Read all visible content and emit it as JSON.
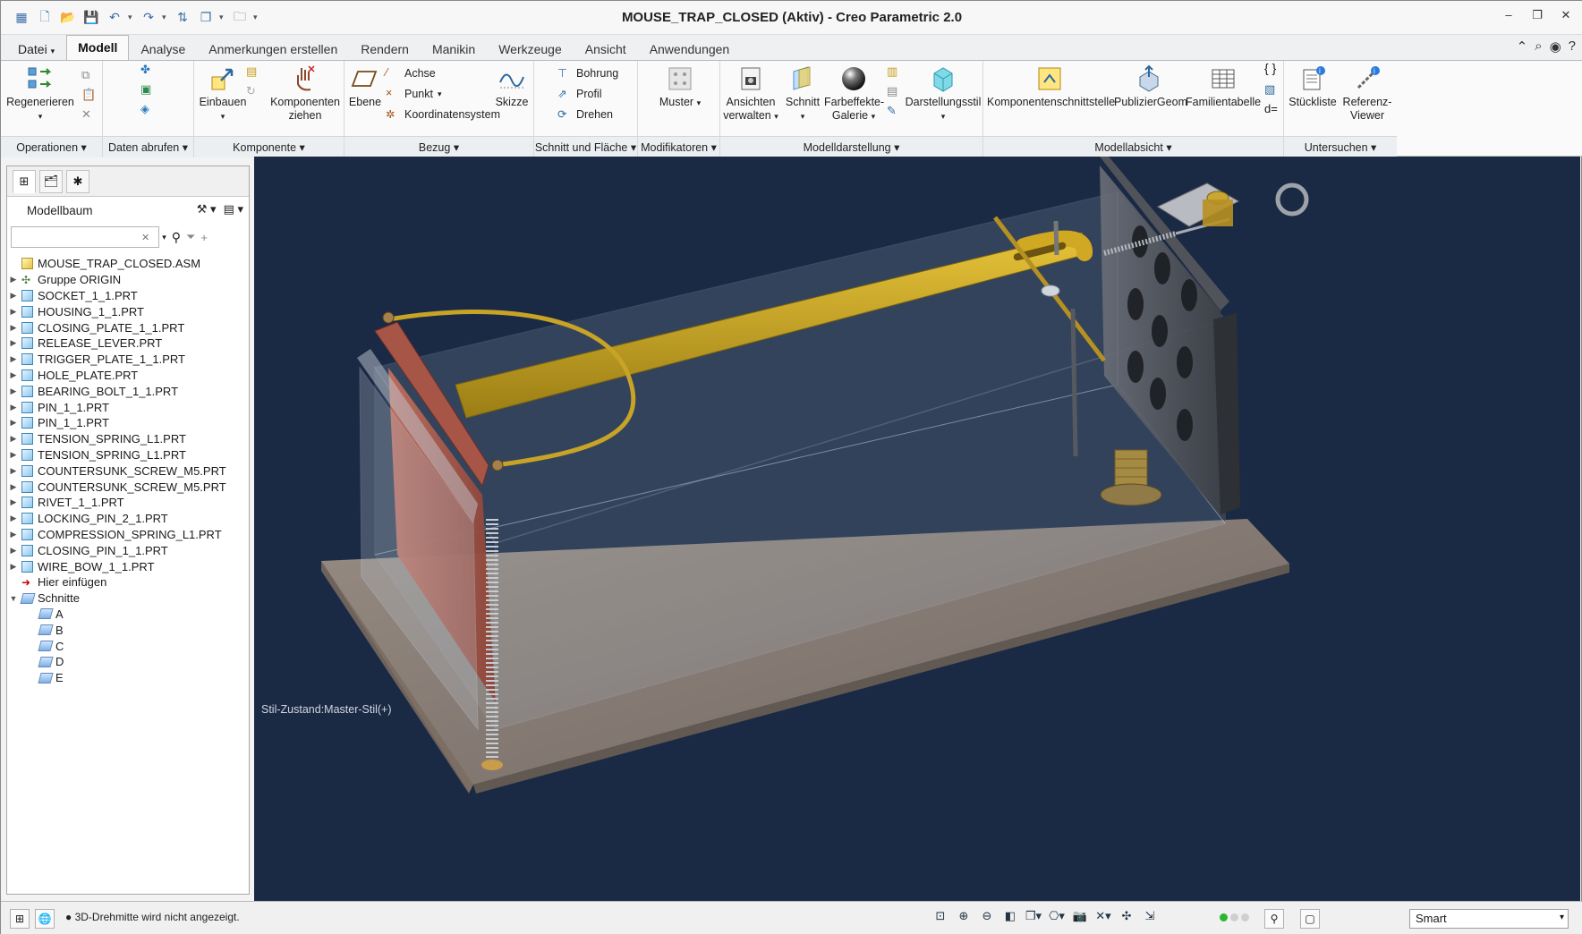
{
  "window": {
    "title": "MOUSE_TRAP_CLOSED (Aktiv) - Creo Parametric 2.0",
    "controls": [
      "minimize-icon",
      "restore-icon",
      "close-icon"
    ]
  },
  "tabs": [
    {
      "label": "Datei",
      "dropdown": "▾"
    },
    {
      "label": "Modell"
    },
    {
      "label": "Analyse"
    },
    {
      "label": "Anmerkungen erstellen"
    },
    {
      "label": "Rendern"
    },
    {
      "label": "Manikin"
    },
    {
      "label": "Werkzeuge"
    },
    {
      "label": "Ansicht"
    },
    {
      "label": "Anwendungen"
    }
  ],
  "active_tab": "Modell",
  "ribbon": {
    "operationen": {
      "label": "Operationen",
      "regenerieren": "Regenerieren"
    },
    "daten_abrufen": {
      "label": "Daten abrufen"
    },
    "komponente": {
      "label": "Komponente",
      "einbauen": "Einbauen",
      "komponenten_ziehen_1": "Komponenten",
      "komponenten_ziehen_2": "ziehen"
    },
    "bezug": {
      "label": "Bezug",
      "ebene": "Ebene",
      "achse": "Achse",
      "punkt": "Punkt",
      "koordinatensystem": "Koordinatensystem",
      "skizze": "Skizze"
    },
    "schnitt_flaeche": {
      "label": "Schnitt und Fläche",
      "bohrung": "Bohrung",
      "profil": "Profil",
      "drehen": "Drehen"
    },
    "modifikatoren": {
      "label": "Modifikatoren",
      "muster": "Muster"
    },
    "modelldarstellung": {
      "label": "Modelldarstellung",
      "ansichten_1": "Ansichten",
      "ansichten_2": "verwalten",
      "schnitt": "Schnitt",
      "farbeffekte_1": "Farbeffekte-",
      "farbeffekte_2": "Galerie",
      "darstellungsstil": "Darstellungsstil"
    },
    "modellabsicht": {
      "label": "Modellabsicht",
      "komponentenschnittstelle": "Komponentenschnittstelle",
      "publiziergeom": "PublizierGeom",
      "familientabelle": "Familientabelle",
      "d_equals": "d="
    },
    "untersuchen": {
      "label": "Untersuchen",
      "stueckliste": "Stückliste",
      "referenz_1": "Referenz-",
      "referenz_2": "Viewer"
    }
  },
  "model_tree": {
    "title": "Modellbaum",
    "search_value": "",
    "items": [
      {
        "label": "MOUSE_TRAP_CLOSED.ASM",
        "kind": "assembly",
        "expander": ""
      },
      {
        "label": "Gruppe ORIGIN",
        "kind": "group",
        "expander": "▶"
      },
      {
        "label": "SOCKET_1_1.PRT",
        "kind": "part",
        "expander": "▶"
      },
      {
        "label": "HOUSING_1_1.PRT",
        "kind": "part",
        "expander": "▶"
      },
      {
        "label": "CLOSING_PLATE_1_1.PRT",
        "kind": "part",
        "expander": "▶"
      },
      {
        "label": "RELEASE_LEVER.PRT",
        "kind": "part",
        "expander": "▶"
      },
      {
        "label": "TRIGGER_PLATE_1_1.PRT",
        "kind": "part",
        "expander": "▶"
      },
      {
        "label": "HOLE_PLATE.PRT",
        "kind": "part",
        "expander": "▶"
      },
      {
        "label": "BEARING_BOLT_1_1.PRT",
        "kind": "part",
        "expander": "▶"
      },
      {
        "label": "PIN_1_1.PRT",
        "kind": "part",
        "expander": "▶"
      },
      {
        "label": "PIN_1_1.PRT",
        "kind": "part",
        "expander": "▶"
      },
      {
        "label": "TENSION_SPRING_L1.PRT",
        "kind": "part",
        "expander": "▶"
      },
      {
        "label": "TENSION_SPRING_L1.PRT",
        "kind": "part",
        "expander": "▶"
      },
      {
        "label": "COUNTERSUNK_SCREW_M5.PRT",
        "kind": "part",
        "expander": "▶"
      },
      {
        "label": "COUNTERSUNK_SCREW_M5.PRT",
        "kind": "part",
        "expander": "▶"
      },
      {
        "label": "RIVET_1_1.PRT",
        "kind": "part",
        "expander": "▶"
      },
      {
        "label": "LOCKING_PIN_2_1.PRT",
        "kind": "part",
        "expander": "▶"
      },
      {
        "label": "COMPRESSION_SPRING_L1.PRT",
        "kind": "part",
        "expander": "▶"
      },
      {
        "label": "CLOSING_PIN_1_1.PRT",
        "kind": "part",
        "expander": "▶"
      },
      {
        "label": "WIRE_BOW_1_1.PRT",
        "kind": "part",
        "expander": "▶"
      },
      {
        "label": "Hier einfügen",
        "kind": "insert",
        "expander": ""
      },
      {
        "label": "Schnitte",
        "kind": "sections",
        "expander": "▼"
      },
      {
        "label": "A",
        "kind": "section",
        "expander": "",
        "indent": 1
      },
      {
        "label": "B",
        "kind": "section",
        "expander": "",
        "indent": 1
      },
      {
        "label": "C",
        "kind": "section",
        "expander": "",
        "indent": 1
      },
      {
        "label": "D",
        "kind": "section",
        "expander": "",
        "indent": 1
      },
      {
        "label": "E",
        "kind": "section",
        "expander": "",
        "indent": 1
      }
    ]
  },
  "viewport": {
    "style_status": "Stil-Zustand:Master-Stil(+)"
  },
  "statusbar": {
    "message": "3D-Drehmitte wird nicht angezeigt.",
    "filter_value": "Smart"
  },
  "colors": {
    "viewport_bg": "#1b2a44",
    "accent_blue": "#3b6ea8",
    "plate_red": "#a7564a",
    "lever_gold": "#c9a421",
    "base_tan": "#8c7e70"
  }
}
